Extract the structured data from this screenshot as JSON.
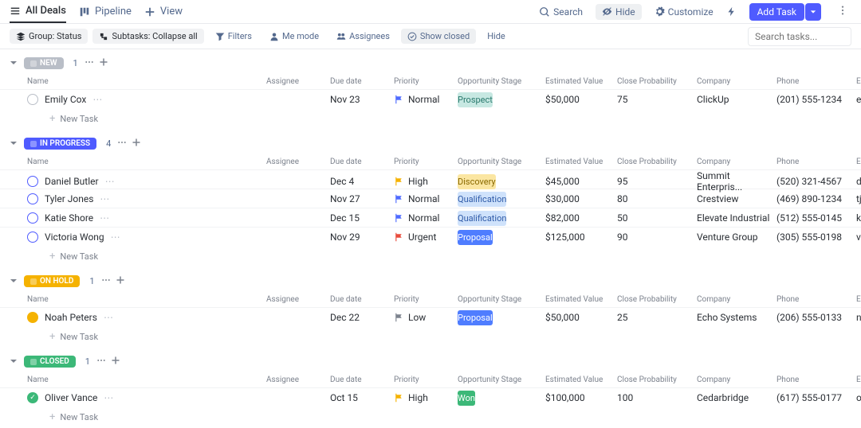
{
  "topbar": {
    "all_deals": "All Deals",
    "pipeline": "Pipeline",
    "view": "View",
    "search": "Search",
    "hide": "Hide",
    "customize": "Customize",
    "add_task": "Add Task"
  },
  "filterbar": {
    "group": "Group: Status",
    "subtasks": "Subtasks: Collapse all",
    "filters": "Filters",
    "me_mode": "Me mode",
    "assignees": "Assignees",
    "show_closed": "Show closed",
    "hide": "Hide",
    "search_placeholder": "Search tasks..."
  },
  "columns": {
    "name": "Name",
    "assignee": "Assignee",
    "due_date": "Due date",
    "priority": "Priority",
    "stage": "Opportunity Stage",
    "est_value": "Estimated Value",
    "close_prob": "Close Probability",
    "company": "Company",
    "phone": "Phone",
    "email": "Email"
  },
  "new_task_label": "New Task",
  "groups": [
    {
      "key": "new",
      "label": "NEW",
      "count": "1",
      "color": "#b9bec7",
      "status_open": true,
      "status_color": "#b9bec7",
      "rows": [
        {
          "name": "Emily Cox",
          "avatar": "av1",
          "due": "Nov 23",
          "priority": "Normal",
          "pflag": "blue",
          "stage": "Prospect",
          "stage_cls": "stage-prospect",
          "value": "$50,000",
          "prob": "75",
          "company": "ClickUp",
          "phone": "(201) 555-1234",
          "email": "ecox@cli"
        }
      ]
    },
    {
      "key": "in_progress",
      "label": "IN PROGRESS",
      "count": "4",
      "color": "#4f5bff",
      "status_open": true,
      "status_color": "#4f5bff",
      "rows": [
        {
          "name": "Daniel Butler",
          "avatar": "av2",
          "due": "Dec 4",
          "priority": "High",
          "pflag": "yellow",
          "stage": "Discovery",
          "stage_cls": "stage-discovery",
          "value": "$45,000",
          "prob": "95",
          "company": "Summit Enterpris...",
          "phone": "(520) 321-4567",
          "email": "dbutler@"
        },
        {
          "name": "Tyler Jones",
          "avatar": "av3",
          "due": "Nov 27",
          "priority": "Normal",
          "pflag": "blue",
          "stage": "Qualification",
          "stage_cls": "stage-qual",
          "value": "$30,000",
          "prob": "80",
          "company": "Crestview",
          "phone": "(469) 890-1234",
          "email": "tjones@c"
        },
        {
          "name": "Katie Shore",
          "avatar": "av4",
          "due": "Dec 15",
          "priority": "Normal",
          "pflag": "blue",
          "stage": "Qualification",
          "stage_cls": "stage-qual",
          "value": "$82,000",
          "prob": "50",
          "company": "Elevate Industrial",
          "phone": "(512) 555-0145",
          "email": "kshore@"
        },
        {
          "name": "Victoria Wong",
          "avatar": "av5",
          "due": "Nov 29",
          "priority": "Urgent",
          "pflag": "red",
          "stage": "Proposal",
          "stage_cls": "stage-proposal",
          "value": "$125,000",
          "prob": "90",
          "company": "Venture Group",
          "phone": "(305) 555-0198",
          "email": "vwong@"
        }
      ]
    },
    {
      "key": "on_hold",
      "label": "ON HOLD",
      "count": "1",
      "color": "#f5b200",
      "status_open": false,
      "status_color": "#f5b200",
      "rows": [
        {
          "name": "Noah Peters",
          "avatar": "av6",
          "due": "Dec 22",
          "priority": "Low",
          "pflag": "grey",
          "stage": "Proposal",
          "stage_cls": "stage-proposal",
          "value": "$50,000",
          "prob": "25",
          "company": "Echo Systems",
          "phone": "(206) 555-0133",
          "email": "npeters@"
        }
      ]
    },
    {
      "key": "closed",
      "label": "CLOSED",
      "count": "1",
      "color": "#3cb878",
      "status_open": false,
      "status_color": "#3cb878",
      "status_check": true,
      "rows": [
        {
          "name": "Oliver Vance",
          "avatar": "av7",
          "due": "Oct 15",
          "priority": "High",
          "pflag": "yellow",
          "stage": "Won",
          "stage_cls": "stage-won",
          "value": "$100,000",
          "prob": "100",
          "company": "Cedarbridge",
          "phone": "(617) 555-0177",
          "email": "ovance@"
        }
      ]
    }
  ]
}
